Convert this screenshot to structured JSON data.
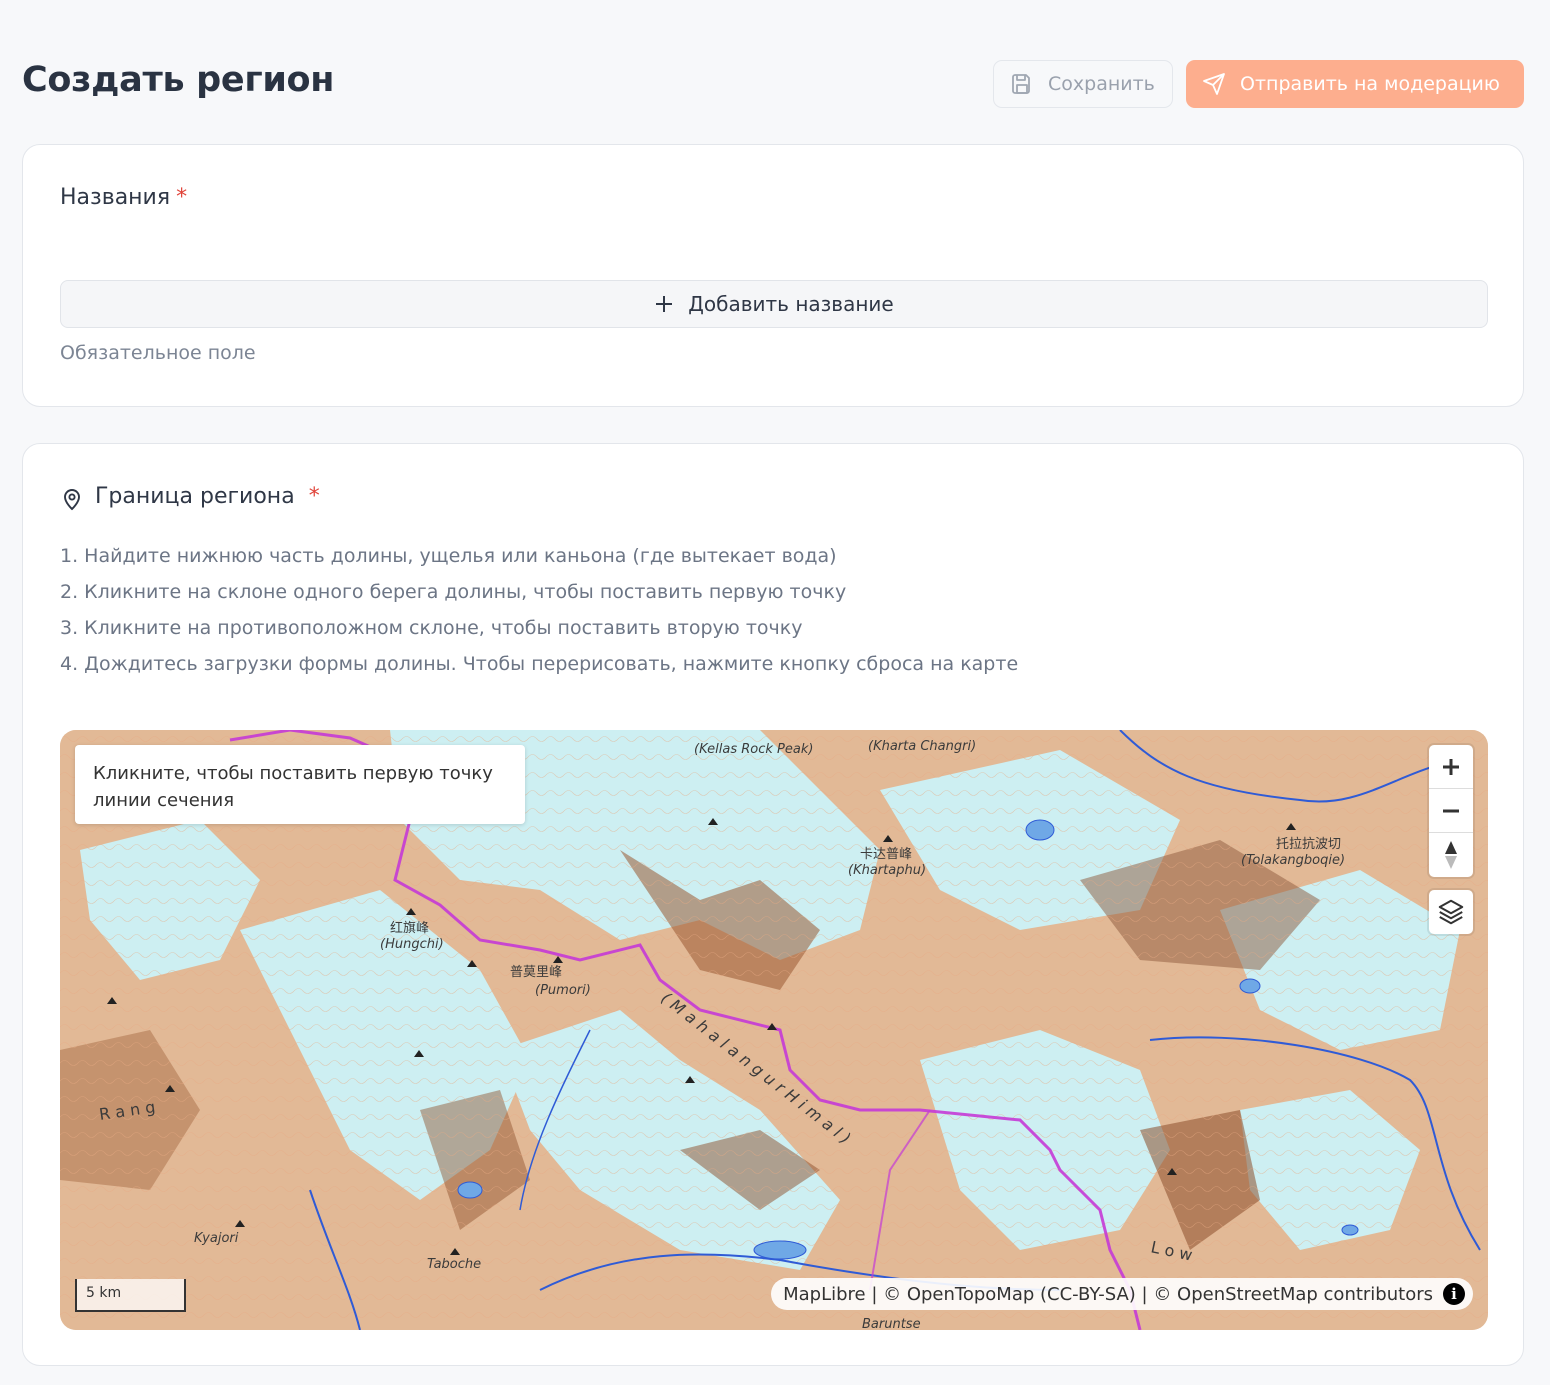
{
  "header": {
    "title": "Создать регион",
    "save_label": "Сохранить",
    "send_label": "Отправить на модерацию"
  },
  "names_section": {
    "label": "Названия",
    "required_mark": "*",
    "add_button_label": "Добавить название",
    "hint": "Обязательное поле"
  },
  "border_section": {
    "label": "Граница региона",
    "required_mark": "*",
    "steps": [
      "1. Найдите нижнюю часть долины, ущелья или каньона (где вытекает вода)",
      "2. Кликните на склоне одного берега долины, чтобы поставить первую точку",
      "3. Кликните на противоположном склоне, чтобы поставить вторую точку",
      "4. Дождитесь загрузки формы долины. Чтобы перерисовать, нажмите кнопку сброса на карте"
    ]
  },
  "map": {
    "tooltip": "Кликните, чтобы поставить первую точку линии сечения",
    "scale": "5 km",
    "attribution": "MapLibre | © OpenTopoMap (CC-BY-SA) | © OpenStreetMap contributors",
    "info_glyph": "i",
    "labels": {
      "kellas": "(Kellas Rock Peak)",
      "kharta_changri": "(Kharta Changri)",
      "khartaphu_cn": "卡达普峰",
      "khartaphu": "(Khartaphu)",
      "tolakang_cn": "托拉抗波切",
      "tolakang": "(Tolakangboqie)",
      "hungchi_cn": "红旗峰",
      "hungchi": "(Hungchi)",
      "pumori_cn": "普莫里峰",
      "pumori": "(Pumori)",
      "mahalangur": "( M a h a l a n g u r   H i m a l )",
      "rangan": "R a n g",
      "kyajori": "Kyajori",
      "taboche": "Taboche",
      "baruntse": "Baruntse",
      "low": "L o w"
    }
  },
  "colors": {
    "accent": "#fdae8e",
    "required": "#e0453b",
    "glacier": "#cdeff2",
    "rock": "#d9a47d",
    "border_line": "#c53ad6",
    "river": "#2f5bd6"
  }
}
